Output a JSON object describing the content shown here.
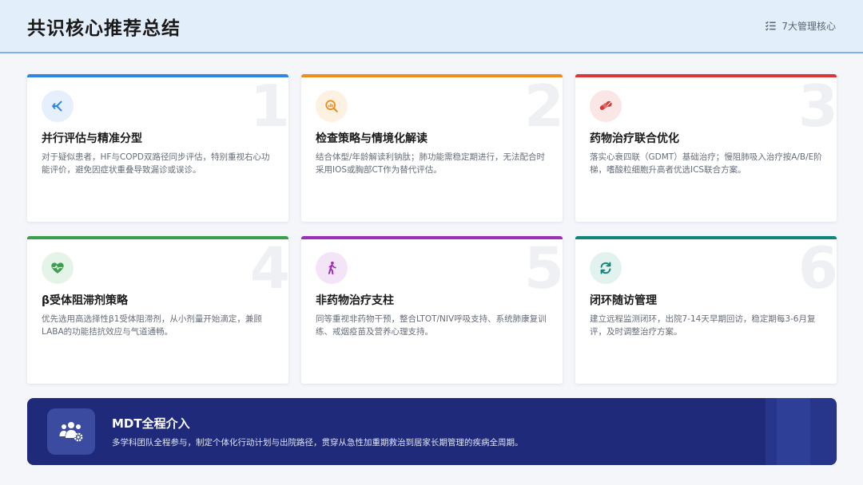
{
  "header": {
    "title": "共识核心推荐总结",
    "badge_icon": "checklist-icon",
    "badge_text": "7大管理核心"
  },
  "cards": [
    {
      "number": "1",
      "title": "并行评估与精准分型",
      "desc": "对于疑似患者，HF与COPD双路径同步评估，特别重视右心功能评价，避免因症状重叠导致漏诊或误诊。",
      "accent": "#2f86e0",
      "icon_bg": "#e5f0fc",
      "icon": "split-path-icon"
    },
    {
      "number": "2",
      "title": "检查策略与情境化解读",
      "desc": "结合体型/年龄解读利钠肽；肺功能需稳定期进行，无法配合时采用IOS或胸部CT作为替代评估。",
      "accent": "#ee8c1e",
      "icon_bg": "#fdf1e2",
      "icon": "search-chart-icon"
    },
    {
      "number": "3",
      "title": "药物治疗联合优化",
      "desc": "落实心衰四联（GDMT）基础治疗；慢阻肺吸入治疗按A/B/E阶梯，嗜酸粒细胞升高者优选ICS联合方案。",
      "accent": "#d93636",
      "icon_bg": "#fbe6e6",
      "icon": "pills-icon"
    },
    {
      "number": "4",
      "title": "β受体阻滞剂策略",
      "desc": "优先选用高选择性β1受体阻滞剂，从小剂量开始滴定，兼顾LABA的功能拮抗效应与气道通畅。",
      "accent": "#3a9e4a",
      "icon_bg": "#e5f4e8",
      "icon": "heart-pulse-icon"
    },
    {
      "number": "5",
      "title": "非药物治疗支柱",
      "desc": "同等重视非药物干预，整合LTOT/NIV呼吸支持、系统肺康复训练、戒烟疫苗及营养心理支持。",
      "accent": "#9b2fb5",
      "icon_bg": "#f3e5f7",
      "icon": "walking-person-icon"
    },
    {
      "number": "6",
      "title": "闭环随访管理",
      "desc": "建立远程监测闭环，出院7-14天早期回访，稳定期每3-6月复评，及时调整治疗方案。",
      "accent": "#12857a",
      "icon_bg": "#e1f2ef",
      "icon": "refresh-cycle-icon"
    }
  ],
  "mdt": {
    "title": "MDT全程介入",
    "desc": "多学科团队全程参与，制定个体化行动计划与出院路径，贯穿从急性加重期救治到居家长期管理的疾病全周期。",
    "icon": "team-gear-icon"
  }
}
